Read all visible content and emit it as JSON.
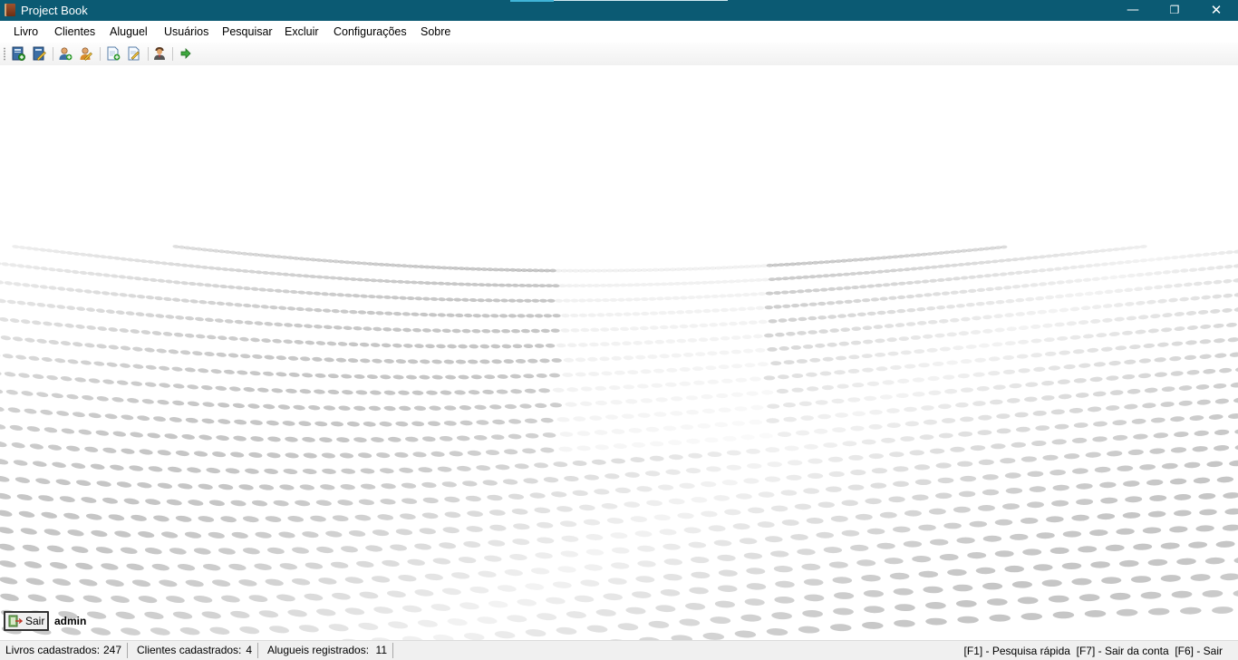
{
  "window": {
    "title": "Project Book",
    "minimize_glyph": "—",
    "maximize_glyph": "❐",
    "close_glyph": "✕"
  },
  "menu": {
    "items": [
      "Livro",
      "Clientes",
      "Aluguel",
      "Usuários",
      "Pesquisar",
      "Excluir",
      "Configurações",
      "Sobre"
    ]
  },
  "toolbar": {
    "buttons": [
      {
        "icon": "book-add-icon"
      },
      {
        "icon": "book-edit-icon"
      },
      {
        "icon": "user-add-icon"
      },
      {
        "icon": "user-edit-icon"
      },
      {
        "icon": "document-add-icon"
      },
      {
        "icon": "document-edit-icon"
      },
      {
        "icon": "admin-user-icon"
      },
      {
        "icon": "arrow-right-icon"
      }
    ]
  },
  "session": {
    "logout_label": "Sair",
    "username": "admin"
  },
  "status": {
    "books_label": "Livros cadastrados:",
    "books_count": "247",
    "clients_label": "Clientes cadastrados:",
    "clients_count": "4",
    "rentals_label": "Alugueis registrados:",
    "rentals_count": "11",
    "shortcuts": "[F1] - Pesquisa rápida  [F7] - Sair da conta  [F6] - Sair"
  },
  "colors": {
    "titlebar": "#0b5a73",
    "dot_wave": "#9a9a9a"
  }
}
